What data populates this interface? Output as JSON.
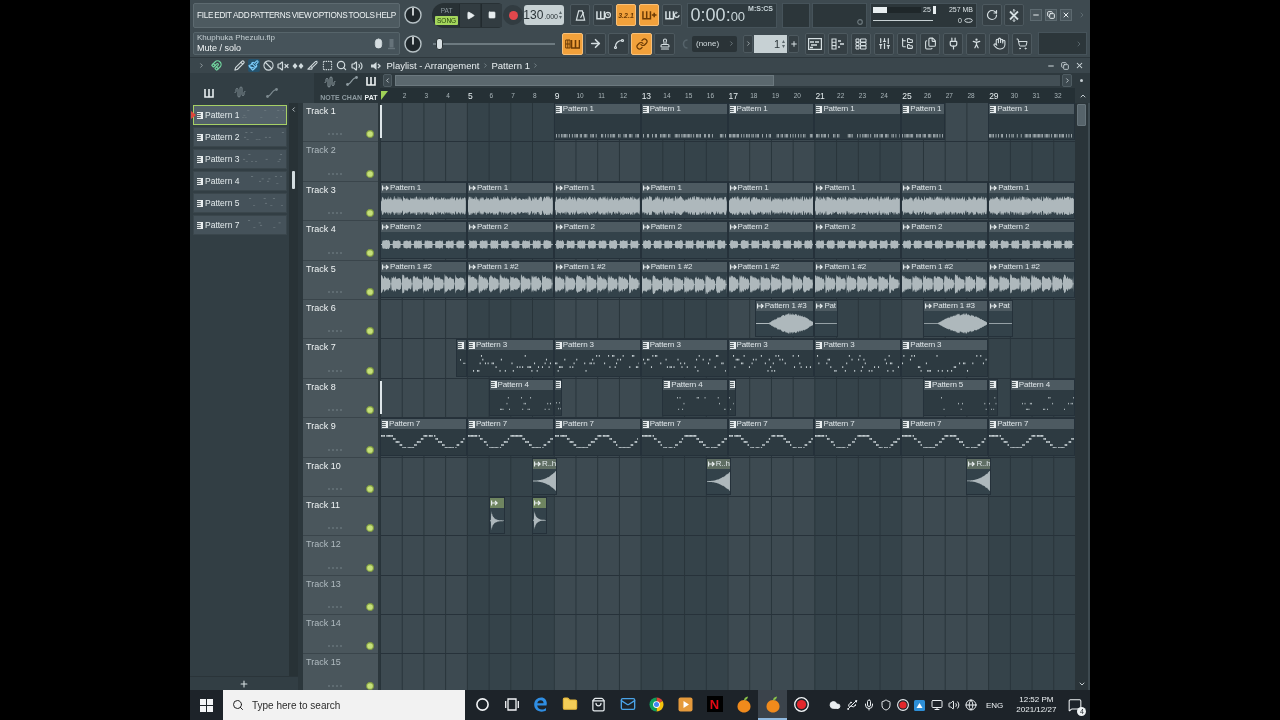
{
  "menu": [
    "FILE",
    "EDIT",
    "ADD",
    "PATTERNS",
    "VIEW",
    "OPTIONS",
    "TOOLS",
    "HELP"
  ],
  "transport": {
    "modes": [
      {
        "label": "PAT",
        "selected": false
      },
      {
        "label": "SONG",
        "selected": true
      }
    ],
    "tempo": "130",
    "tempo_fraction": ".000"
  },
  "toggles": [
    {
      "kind": "metronome",
      "on": false
    },
    {
      "kind": "wait",
      "on": false
    },
    {
      "kind": "countdown",
      "label": "3.2.1",
      "on": true
    },
    {
      "kind": "stepedit",
      "on": true
    },
    {
      "kind": "looprecord",
      "on": false
    }
  ],
  "clock": {
    "time": "0:00:",
    "fraction": "00",
    "format": "M:S:CS"
  },
  "monitor": {
    "cpu": {
      "level": 0.3,
      "reading": "25"
    },
    "memory": "257 MB",
    "polyphony": "0"
  },
  "hint": {
    "file": "Khuphuka Phezulu.flp",
    "text": "Mute / solo"
  },
  "pitch_slider": {
    "level": 0.03
  },
  "snap_tools": [
    {
      "kind": "snap",
      "on": true
    },
    {
      "kind": "arrow",
      "on": false
    },
    {
      "kind": "curve",
      "on": false
    },
    {
      "kind": "link",
      "on": true
    },
    {
      "kind": "stamp",
      "on": false
    }
  ],
  "pattern_selector": {
    "value": "(none)"
  },
  "pattern_number": {
    "value": "1"
  },
  "windows": [
    {
      "kind": "playlist"
    },
    {
      "kind": "pianoroll"
    },
    {
      "kind": "channels"
    },
    {
      "kind": "mixer"
    },
    {
      "kind": "browser"
    },
    {
      "kind": "clone"
    },
    {
      "kind": "plugin"
    },
    {
      "kind": "touch"
    },
    {
      "kind": "hand"
    },
    {
      "kind": "cart"
    }
  ],
  "playlist": {
    "title": "Playlist - Arrangement",
    "pattern": "Pattern 1",
    "snap": {
      "on": true
    },
    "tools": [
      {
        "kind": "draw",
        "selected": false
      },
      {
        "kind": "paint",
        "selected": true
      },
      {
        "kind": "delete",
        "selected": false
      },
      {
        "kind": "mute",
        "selected": false
      },
      {
        "kind": "slip",
        "selected": false
      },
      {
        "kind": "slice",
        "selected": false
      },
      {
        "kind": "select",
        "selected": false
      },
      {
        "kind": "zoom",
        "selected": false
      },
      {
        "kind": "playback",
        "selected": false
      }
    ],
    "picker_filters": [
      {
        "kind": "pattern",
        "selected": true
      },
      {
        "kind": "audio",
        "selected": false
      },
      {
        "kind": "automation",
        "selected": false
      }
    ],
    "patterns": [
      {
        "name": "Pattern 1",
        "selected": true
      },
      {
        "name": "Pattern 2",
        "selected": false
      },
      {
        "name": "Pattern 3",
        "selected": false
      },
      {
        "name": "Pattern 4",
        "selected": false
      },
      {
        "name": "Pattern 5",
        "selected": false
      },
      {
        "name": "Pattern 7",
        "selected": false
      }
    ],
    "track_filters": [
      {
        "kind": "audio",
        "label": "NOTE",
        "selected": false
      },
      {
        "kind": "automation",
        "label": "CHAN",
        "selected": false
      },
      {
        "kind": "pattern",
        "label": "PAT",
        "selected": true
      }
    ],
    "ruler": [
      "2",
      "3",
      "4",
      "5",
      "6",
      "7",
      "8",
      "9",
      "10",
      "11",
      "12",
      "13",
      "14",
      "15",
      "16",
      "17",
      "18",
      "19",
      "20",
      "21",
      "22",
      "23",
      "24",
      "25",
      "26",
      "27",
      "28",
      "29",
      "30",
      "31",
      "32"
    ],
    "tracks": [
      {
        "name": "Track 1",
        "empty": false,
        "enabled": true,
        "marker": true,
        "clips": [
          {
            "kind": "pattern",
            "label": "Pattern 1"
          },
          {
            "kind": "pattern",
            "label": "Pattern 1"
          },
          {
            "kind": "pattern",
            "label": "Pattern 1"
          },
          {
            "kind": "pattern",
            "label": "Pattern 1"
          },
          {
            "kind": "pattern",
            "label": "Pattern 1"
          },
          {
            "kind": "pattern",
            "label": "Pattern 1"
          }
        ]
      },
      {
        "name": "Track 2",
        "empty": true,
        "enabled": true,
        "marker": false
      },
      {
        "name": "Track 3",
        "empty": false,
        "enabled": true,
        "marker": false,
        "clips": [
          {
            "kind": "audio",
            "label": "Pattern 1"
          },
          {
            "kind": "audio",
            "label": "Pattern 1"
          },
          {
            "kind": "audio",
            "label": "Pattern 1"
          },
          {
            "kind": "audio",
            "label": "Pattern 1"
          },
          {
            "kind": "audio",
            "label": "Pattern 1"
          },
          {
            "kind": "audio",
            "label": "Pattern 1"
          },
          {
            "kind": "audio",
            "label": "Pattern 1"
          },
          {
            "kind": "audio",
            "label": "Pattern 1"
          }
        ]
      },
      {
        "name": "Track 4",
        "empty": false,
        "enabled": true,
        "marker": false,
        "clips": [
          {
            "kind": "audio",
            "label": "Pattern 2"
          },
          {
            "kind": "audio",
            "label": "Pattern 2"
          },
          {
            "kind": "audio",
            "label": "Pattern 2"
          },
          {
            "kind": "audio",
            "label": "Pattern 2"
          },
          {
            "kind": "audio",
            "label": "Pattern 2"
          },
          {
            "kind": "audio",
            "label": "Pattern 2"
          },
          {
            "kind": "audio",
            "label": "Pattern 2"
          },
          {
            "kind": "audio",
            "label": "Pattern 2"
          }
        ]
      },
      {
        "name": "Track 5",
        "empty": false,
        "enabled": true,
        "marker": false,
        "clips": [
          {
            "kind": "audio",
            "label": "Pattern 1 #2"
          },
          {
            "kind": "audio",
            "label": "Pattern 1 #2"
          },
          {
            "kind": "audio",
            "label": "Pattern 1 #2"
          },
          {
            "kind": "audio",
            "label": "Pattern 1 #2"
          },
          {
            "kind": "audio",
            "label": "Pattern 1 #2"
          },
          {
            "kind": "audio",
            "label": "Pattern 1 #2"
          },
          {
            "kind": "audio",
            "label": "Pattern 1 #2"
          },
          {
            "kind": "audio",
            "label": "Pattern 1 #2"
          }
        ]
      },
      {
        "name": "Track 6",
        "empty": false,
        "enabled": true,
        "marker": false,
        "clips": [
          {
            "kind": "audio",
            "label": "Pattern 1 #3"
          },
          {
            "kind": "audio",
            "label": "Pat"
          },
          {
            "kind": "audio",
            "label": "Pattern 1 #3"
          },
          {
            "kind": "audio",
            "label": "Pat"
          }
        ]
      },
      {
        "name": "Track 7",
        "empty": false,
        "enabled": true,
        "marker": false,
        "clips": [
          {
            "kind": "pattern"
          },
          {
            "kind": "pattern",
            "label": "Pattern 3"
          },
          {
            "kind": "pattern",
            "label": "Pattern 3"
          },
          {
            "kind": "pattern",
            "label": "Pattern 3"
          },
          {
            "kind": "pattern",
            "label": "Pattern 3"
          },
          {
            "kind": "pattern",
            "label": "Pattern 3"
          },
          {
            "kind": "pattern",
            "label": "Pattern 3"
          }
        ]
      },
      {
        "name": "Track 8",
        "empty": false,
        "enabled": true,
        "marker": true,
        "clips": [
          {
            "kind": "pattern",
            "label": "Pattern 4"
          },
          {
            "kind": "pattern"
          },
          {
            "kind": "pattern",
            "label": "Pattern 4"
          },
          {
            "kind": "pattern"
          },
          {
            "kind": "pattern",
            "label": "Pattern 5"
          },
          {
            "kind": "pattern"
          },
          {
            "kind": "pattern",
            "label": "Pattern 4"
          }
        ]
      },
      {
        "name": "Track 9",
        "empty": false,
        "enabled": true,
        "marker": false,
        "clips": [
          {
            "kind": "pattern",
            "label": "Pattern 7"
          },
          {
            "kind": "pattern",
            "label": "Pattern 7"
          },
          {
            "kind": "pattern",
            "label": "Pattern 7"
          },
          {
            "kind": "pattern",
            "label": "Pattern 7"
          },
          {
            "kind": "pattern",
            "label": "Pattern 7"
          },
          {
            "kind": "pattern",
            "label": "Pattern 7"
          },
          {
            "kind": "pattern",
            "label": "Pattern 7"
          },
          {
            "kind": "pattern",
            "label": "Pattern 7"
          }
        ]
      },
      {
        "name": "Track 10",
        "empty": false,
        "enabled": true,
        "marker": false,
        "clips": [
          {
            "kind": "audio",
            "label": "R..h",
            "color": "#5f6e63"
          },
          {
            "kind": "audio",
            "label": "R..h",
            "color": "#5f6e63"
          },
          {
            "kind": "audio",
            "label": "R..h",
            "color": "#5f6e63"
          }
        ]
      },
      {
        "name": "Track 11",
        "empty": false,
        "enabled": true,
        "marker": false,
        "clips": [
          {
            "kind": "audio",
            "color": "#6f8560"
          },
          {
            "kind": "audio",
            "color": "#6f8560"
          }
        ]
      },
      {
        "name": "Track 12",
        "empty": true,
        "enabled": true,
        "marker": false
      },
      {
        "name": "Track 13",
        "empty": true,
        "enabled": true,
        "marker": false
      },
      {
        "name": "Track 14",
        "empty": true,
        "enabled": true,
        "marker": false
      },
      {
        "name": "Track 15",
        "empty": true,
        "enabled": true,
        "marker": false
      }
    ]
  },
  "taskbar": {
    "search": {
      "placeholder": "Type here to search"
    },
    "apps": [
      {
        "kind": "assistant",
        "active": false
      },
      {
        "kind": "taskview",
        "active": false
      },
      {
        "kind": "browser",
        "active": false
      },
      {
        "kind": "files",
        "active": false
      },
      {
        "kind": "store",
        "active": false
      },
      {
        "kind": "mail",
        "active": false
      },
      {
        "kind": "web",
        "active": false
      },
      {
        "kind": "player",
        "active": false
      },
      {
        "kind": "video",
        "label": "N",
        "active": false
      },
      {
        "kind": "daw",
        "active": false
      },
      {
        "kind": "daw",
        "active": true
      },
      {
        "kind": "recorder",
        "active": false
      }
    ],
    "tray": [
      {
        "kind": "cloud"
      },
      {
        "kind": "usb"
      },
      {
        "kind": "mic"
      },
      {
        "kind": "security"
      },
      {
        "kind": "recording"
      },
      {
        "kind": "app"
      },
      {
        "kind": "network"
      },
      {
        "kind": "volume"
      },
      {
        "kind": "globe"
      }
    ],
    "language": "ENG",
    "time": "12:52 PM",
    "date": "2021/12/27",
    "notifications": "4"
  }
}
